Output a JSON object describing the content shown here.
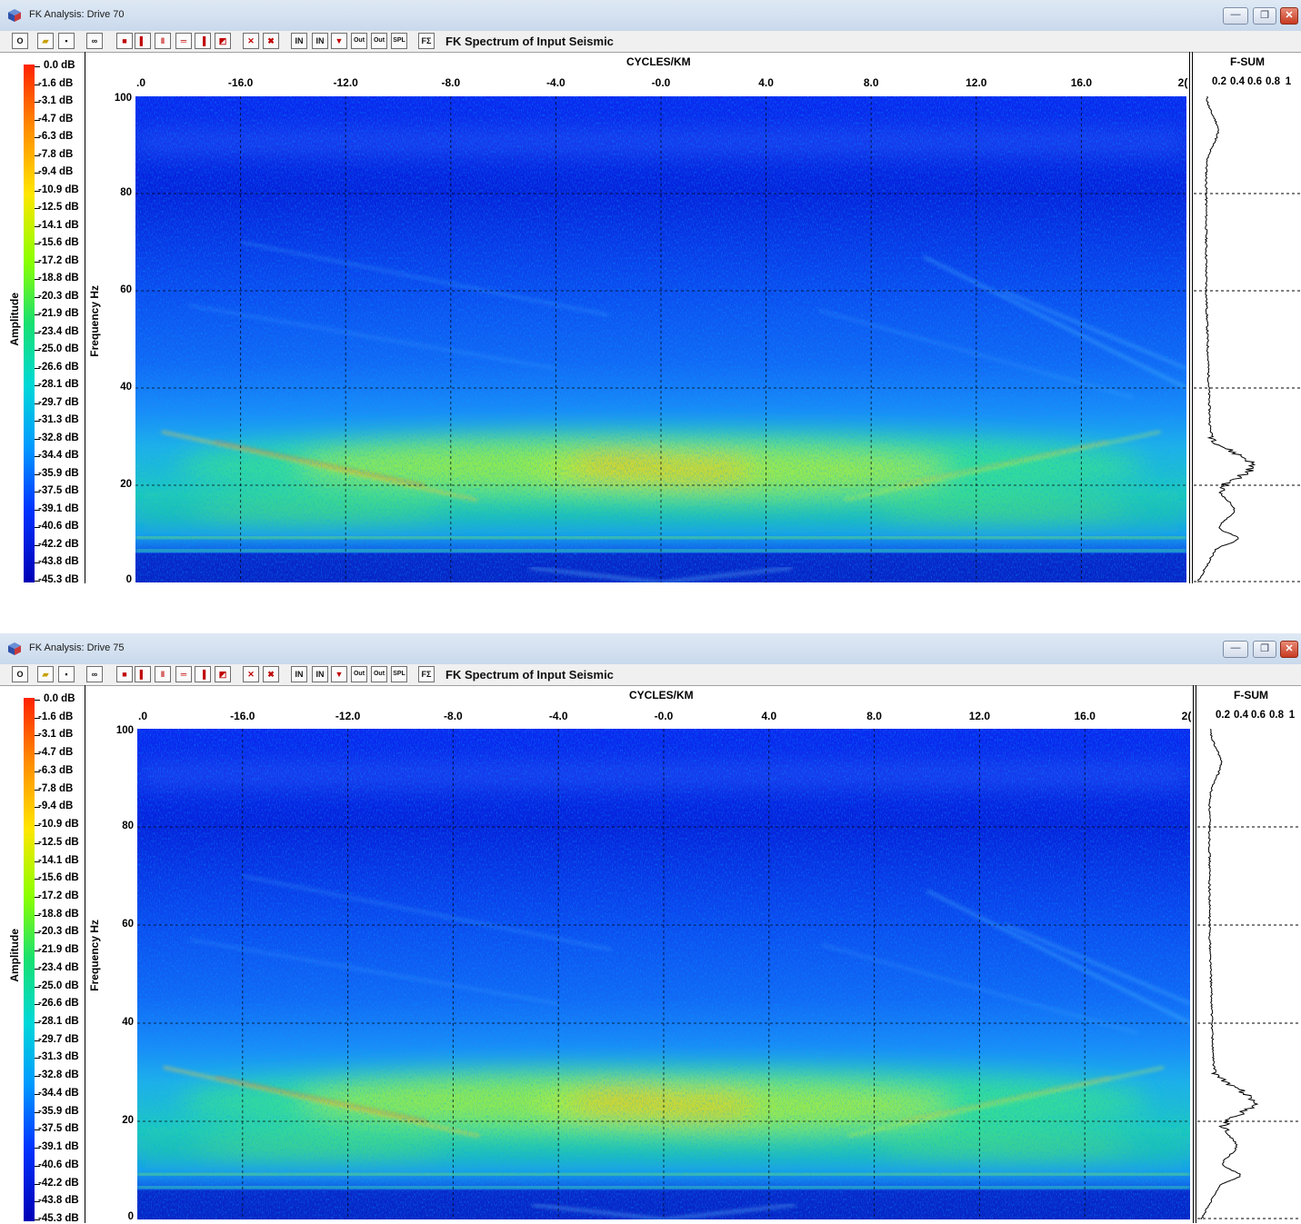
{
  "windows": [
    {
      "title": "FK Analysis: Drive 70",
      "spectrum_label": "FK Spectrum of Input Seismic",
      "x_axis_title": "CYCLES/KM",
      "x_ticks": [
        ".0",
        "-16.0",
        "-12.0",
        "-8.0",
        "-4.0",
        "-0.0",
        "4.0",
        "8.0",
        "12.0",
        "16.0",
        "2("
      ],
      "y_axis_title": "Frequency Hz",
      "y_ticks": [
        "100",
        "80",
        "60",
        "40",
        "20",
        "0"
      ],
      "colorbar_title": "Amplitude",
      "colorbar_labels": [
        "0.0 dB",
        "-1.6 dB",
        "-3.1 dB",
        "-4.7 dB",
        "-6.3 dB",
        "-7.8 dB",
        "-9.4 dB",
        "-10.9 dB",
        "-12.5 dB",
        "-14.1 dB",
        "-15.6 dB",
        "-17.2 dB",
        "-18.8 dB",
        "-20.3 dB",
        "-21.9 dB",
        "-23.4 dB",
        "-25.0 dB",
        "-26.6 dB",
        "-28.1 dB",
        "-29.7 dB",
        "-31.3 dB",
        "-32.8 dB",
        "-34.4 dB",
        "-35.9 dB",
        "-37.5 dB",
        "-39.1 dB",
        "-40.6 dB",
        "-42.2 dB",
        "-43.8 dB",
        "-45.3 dB"
      ],
      "fsum_title": "F-SUM",
      "fsum_ticks": [
        "0.2",
        "0.4",
        "0.6",
        "0.8",
        "1"
      ]
    },
    {
      "title": "FK Analysis: Drive 75",
      "spectrum_label": "FK Spectrum of Input Seismic",
      "x_axis_title": "CYCLES/KM",
      "x_ticks": [
        ".0",
        "-16.0",
        "-12.0",
        "-8.0",
        "-4.0",
        "-0.0",
        "4.0",
        "8.0",
        "12.0",
        "16.0",
        "2("
      ],
      "y_axis_title": "Frequency Hz",
      "y_ticks": [
        "100",
        "80",
        "60",
        "40",
        "20",
        "0"
      ],
      "colorbar_title": "Amplitude",
      "colorbar_labels": [
        "0.0 dB",
        "-1.6 dB",
        "-3.1 dB",
        "-4.7 dB",
        "-6.3 dB",
        "-7.8 dB",
        "-9.4 dB",
        "-10.9 dB",
        "-12.5 dB",
        "-14.1 dB",
        "-15.6 dB",
        "-17.2 dB",
        "-18.8 dB",
        "-20.3 dB",
        "-21.9 dB",
        "-23.4 dB",
        "-25.0 dB",
        "-26.6 dB",
        "-28.1 dB",
        "-29.7 dB",
        "-31.3 dB",
        "-32.8 dB",
        "-34.4 dB",
        "-35.9 dB",
        "-37.5 dB",
        "-39.1 dB",
        "-40.6 dB",
        "-42.2 dB",
        "-43.8 dB",
        "-45.3 dB"
      ],
      "fsum_title": "F-SUM",
      "fsum_ticks": [
        "0.2",
        "0.4",
        "0.6",
        "0.8",
        "1"
      ]
    }
  ],
  "toolbar": {
    "buttons": [
      {
        "name": "open-circle-button",
        "glyph": "O",
        "color": "#111111"
      },
      {
        "name": "open-folder-button",
        "glyph": "▰",
        "color": "#c9a000"
      },
      {
        "name": "save-button",
        "glyph": "▪",
        "color": "#111111"
      },
      {
        "name": "binoculars-button",
        "glyph": "∞",
        "color": "#111111"
      },
      {
        "name": "view-full-button",
        "glyph": "■",
        "color": "#c00000"
      },
      {
        "name": "view-left-button",
        "glyph": "▌",
        "color": "#c00000"
      },
      {
        "name": "view-split-vertical-button",
        "glyph": "‖",
        "color": "#c00000"
      },
      {
        "name": "view-split-horizontal-button",
        "glyph": "═",
        "color": "#c00000"
      },
      {
        "name": "view-right-button",
        "glyph": "▐",
        "color": "#c00000"
      },
      {
        "name": "view-corner-button",
        "glyph": "◩",
        "color": "#c00000"
      },
      {
        "name": "mute-zone-button",
        "glyph": "✕",
        "color": "#c00000"
      },
      {
        "name": "mute-clear-button",
        "glyph": "✖",
        "color": "#c00000"
      },
      {
        "name": "input-in-button",
        "glyph": "IN",
        "color": "#111111"
      },
      {
        "name": "input-in-alt-button",
        "glyph": "IN",
        "color": "#111111"
      },
      {
        "name": "filter-down-button",
        "glyph": "▼",
        "color": "#c00000"
      },
      {
        "name": "output-out-button",
        "glyph": "Out",
        "color": "#111111"
      },
      {
        "name": "output-out-alt-button",
        "glyph": "Out",
        "color": "#111111"
      },
      {
        "name": "spl-button",
        "glyph": "SPL",
        "color": "#111111"
      },
      {
        "name": "fsum-button",
        "glyph": "FΣ",
        "color": "#111111"
      }
    ]
  }
}
